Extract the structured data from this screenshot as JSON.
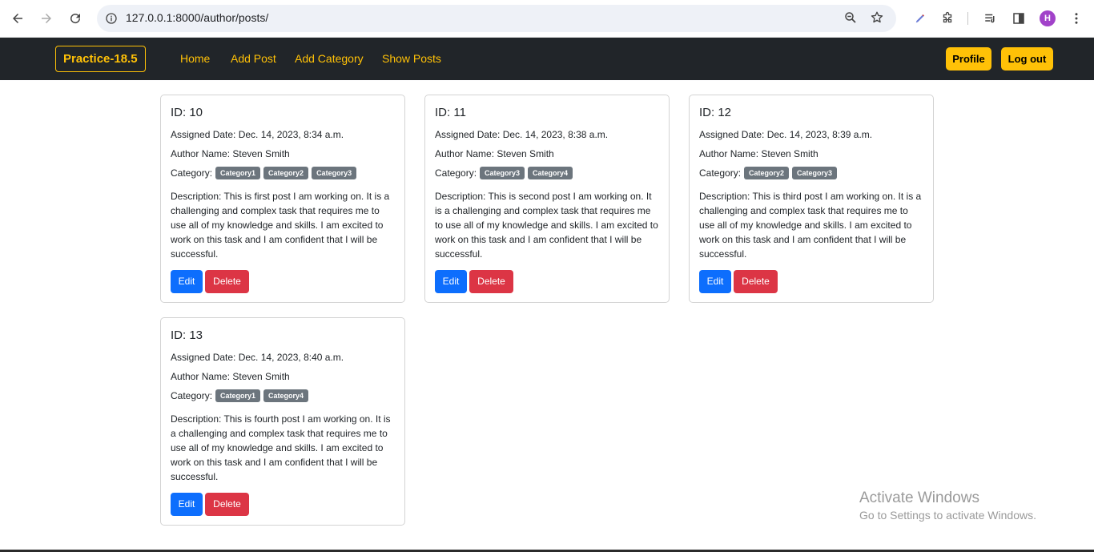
{
  "browser": {
    "url": "127.0.0.1:8000/author/posts/",
    "profile_initial": "H"
  },
  "navbar": {
    "brand": "Practice-18.5",
    "links": [
      "Home",
      "Add Post",
      "Add Category",
      "Show Posts"
    ],
    "profile_label": "Profile",
    "logout_label": "Log out",
    "accent_color": "#ffc107"
  },
  "posts": [
    {
      "id": "ID: 10",
      "assigned": "Assigned Date: Dec. 14, 2023, 8:34 a.m.",
      "author": "Author Name: Steven Smith",
      "category_label": "Category:",
      "categories": [
        "Category1",
        "Category2",
        "Category3"
      ],
      "description": "Description: This is first post I am working on. It is a challenging and complex task that requires me to use all of my knowledge and skills. I am excited to work on this task and I am confident that I will be successful.",
      "edit_label": "Edit",
      "delete_label": "Delete"
    },
    {
      "id": "ID: 11",
      "assigned": "Assigned Date: Dec. 14, 2023, 8:38 a.m.",
      "author": "Author Name: Steven Smith",
      "category_label": "Category:",
      "categories": [
        "Category3",
        "Category4"
      ],
      "description": "Description: This is second post I am working on. It is a challenging and complex task that requires me to use all of my knowledge and skills. I am excited to work on this task and I am confident that I will be successful.",
      "edit_label": "Edit",
      "delete_label": "Delete"
    },
    {
      "id": "ID: 12",
      "assigned": "Assigned Date: Dec. 14, 2023, 8:39 a.m.",
      "author": "Author Name: Steven Smith",
      "category_label": "Category:",
      "categories": [
        "Category2",
        "Category3"
      ],
      "description": "Description: This is third post I am working on. It is a challenging and complex task that requires me to use all of my knowledge and skills. I am excited to work on this task and I am confident that I will be successful.",
      "edit_label": "Edit",
      "delete_label": "Delete"
    },
    {
      "id": "ID: 13",
      "assigned": "Assigned Date: Dec. 14, 2023, 8:40 a.m.",
      "author": "Author Name: Steven Smith",
      "category_label": "Category:",
      "categories": [
        "Category1",
        "Category4"
      ],
      "description": "Description: This is fourth post I am working on. It is a challenging and complex task that requires me to use all of my knowledge and skills. I am excited to work on this task and I am confident that I will be successful.",
      "edit_label": "Edit",
      "delete_label": "Delete"
    }
  ],
  "watermark": {
    "line1": "Activate Windows",
    "line2": "Go to Settings to activate Windows."
  },
  "colors": {
    "edit": "#0d6efd",
    "delete": "#dc3545",
    "badge": "#6c757d",
    "navbar_bg": "#212529"
  }
}
